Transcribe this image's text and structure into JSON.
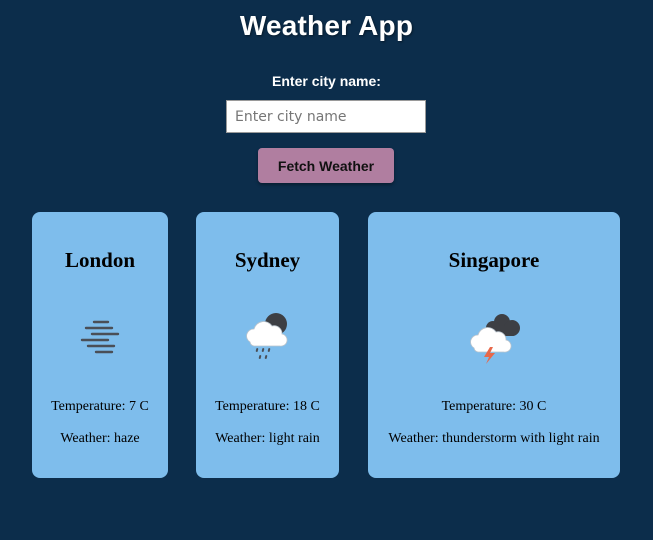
{
  "app": {
    "title": "Weather App",
    "input_label": "Enter city name:",
    "input_placeholder": "Enter city name",
    "input_value": "",
    "button_label": "Fetch Weather"
  },
  "colors": {
    "background": "#0c2d4b",
    "card": "#7ebdec",
    "button": "#b07ea0"
  },
  "cards": [
    {
      "city": "London",
      "icon": "haze-icon",
      "temperature": "Temperature: 7 C",
      "weather": "Weather: haze"
    },
    {
      "city": "Sydney",
      "icon": "light-rain-icon",
      "temperature": "Temperature: 18 C",
      "weather": "Weather: light rain"
    },
    {
      "city": "Singapore",
      "icon": "thunderstorm-icon",
      "temperature": "Temperature: 30 C",
      "weather": "Weather: thunderstorm with light rain"
    }
  ]
}
